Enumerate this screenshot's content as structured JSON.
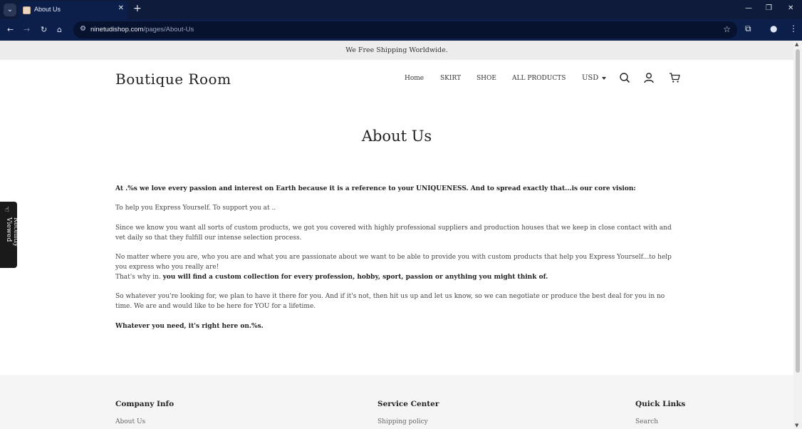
{
  "browser": {
    "tab_title": "About Us",
    "new_tab_glyph": "+",
    "tab_close_glyph": "✕",
    "url_domain": "ninetudishop.com",
    "url_path": "/pages/About-Us",
    "icons": [
      "tab-search-icon",
      "back-icon",
      "forward-icon",
      "reload-icon",
      "home-icon",
      "site-info-icon",
      "bookmark-star-icon",
      "extensions-icon",
      "profile-icon",
      "menu-icon",
      "minimize-icon",
      "restore-icon",
      "close-icon"
    ]
  },
  "announcement": "We Free Shipping Worldwide.",
  "header": {
    "logo": "Boutique Room",
    "nav": [
      {
        "label": "Home"
      },
      {
        "label": "SKIRT"
      },
      {
        "label": "SHOE"
      },
      {
        "label": "ALL PRODUCTS"
      }
    ],
    "currency": "USD",
    "icons": [
      "search-icon",
      "account-icon",
      "cart-icon"
    ]
  },
  "page": {
    "title": "About Us",
    "paragraphs": {
      "p1": "At .%s we love every passion and interest on Earth because it is a reference to your UNIQUENESS. And to spread exactly that...is our core vision:",
      "p2": "To help you Express Yourself. To support you at ..",
      "p3": "Since we know you want all sorts of custom products, we got you covered with highly professional suppliers and production houses that we keep in close contact with and vet daily so that they fulfill our intense selection process.",
      "p4": "No matter where you are, who you are and what you are passionate about we want to be able to provide you with custom products that help you Express Yourself...to help you express who you really are!",
      "p5_prefix": "That's why in. ",
      "p5_bold": "you will find a custom collection for every profession, hobby, sport, passion or anything you might think of.",
      "p6": "So whatever you're looking for, we plan to have it there for you. And if it's not, then hit us up and let us know, so we can negotiate or produce the best deal for you in no time. We are and would like to be here for YOU for a lifetime.",
      "p7": "Whatever you need, it's right here on.%s."
    }
  },
  "recently_viewed": {
    "label": "Recently Viewed",
    "icon": "hand-pointer-icon"
  },
  "footer": {
    "columns": [
      {
        "heading": "Company Info",
        "first_link": "About Us"
      },
      {
        "heading": "Service Center",
        "first_link": "Shipping policy"
      },
      {
        "heading": "Quick Links",
        "first_link": "Search"
      }
    ]
  },
  "colors": {
    "browser_dark": "#0b1f4a",
    "announcement_bg": "#ececec",
    "footer_bg": "#f5f5f5",
    "text": "#222222"
  }
}
